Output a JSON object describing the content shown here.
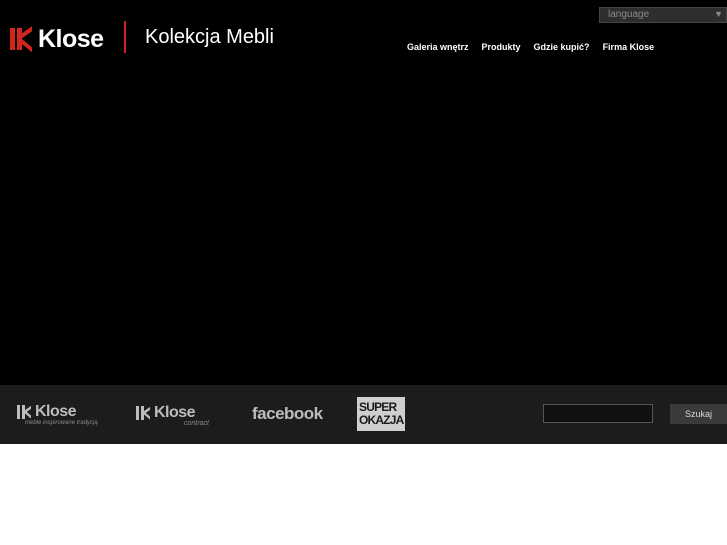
{
  "header": {
    "brand": "Klose",
    "tagline": "Kolekcja Mebli",
    "language_label": "language",
    "nav": [
      {
        "label": "Galeria wnętrz"
      },
      {
        "label": "Produkty"
      },
      {
        "label": "Gdzie kupić?"
      },
      {
        "label": "Firma Klose"
      }
    ]
  },
  "footer": {
    "logo1": {
      "word": "Klose",
      "sub": "meble inspirowane tradycją"
    },
    "logo2": {
      "word": "Klose",
      "sub": "contract"
    },
    "facebook": "facebook",
    "super_line1": "SUPER",
    "super_line2": "OKAZJA",
    "search_button": "Szukaj",
    "search_value": ""
  },
  "colors": {
    "brand_red": "#d0261c",
    "stage": "#000000",
    "footer": "#1c1c1c"
  }
}
